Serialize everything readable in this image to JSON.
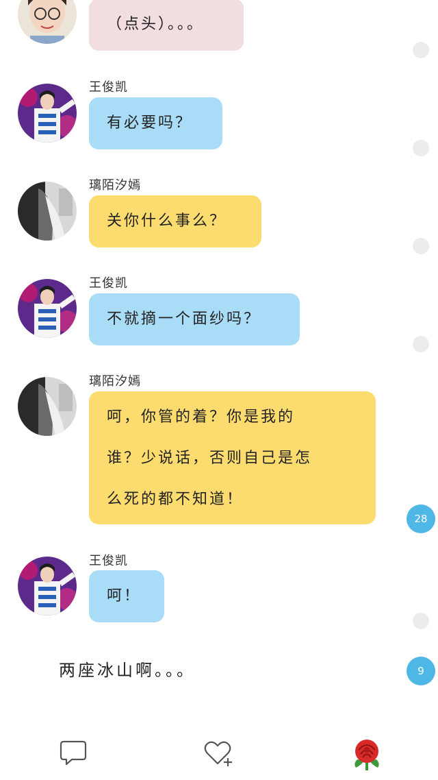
{
  "messages": [
    {
      "sender": "",
      "text": "（点头）。。。"
    },
    {
      "sender": "王俊凯",
      "text": "有必要吗？"
    },
    {
      "sender": "璃陌汐嫣",
      "text": "关你什么事么？"
    },
    {
      "sender": "王俊凯",
      "text": "不就摘一个面纱吗？"
    },
    {
      "sender": "璃陌汐嫣",
      "lines": [
        "呵，你管的着？你是我的",
        "谁？少说话，否则自己是怎",
        "么死的都不知道！"
      ]
    },
    {
      "sender": "王俊凯",
      "text": "呵！"
    }
  ],
  "caption": "两座冰山啊。。。",
  "side_counts": {
    "first": "28",
    "second": "9"
  },
  "toolbar": {
    "comment_icon": "speech-bubble-icon",
    "like_icon": "heart-plus-icon",
    "gift_icon": "rose-icon"
  },
  "colors": {
    "pink_bubble": "#f2dde0",
    "blue_bubble": "#a9dcf6",
    "yellow_bubble": "#fddc6f",
    "count_badge": "#4fb7e6"
  }
}
